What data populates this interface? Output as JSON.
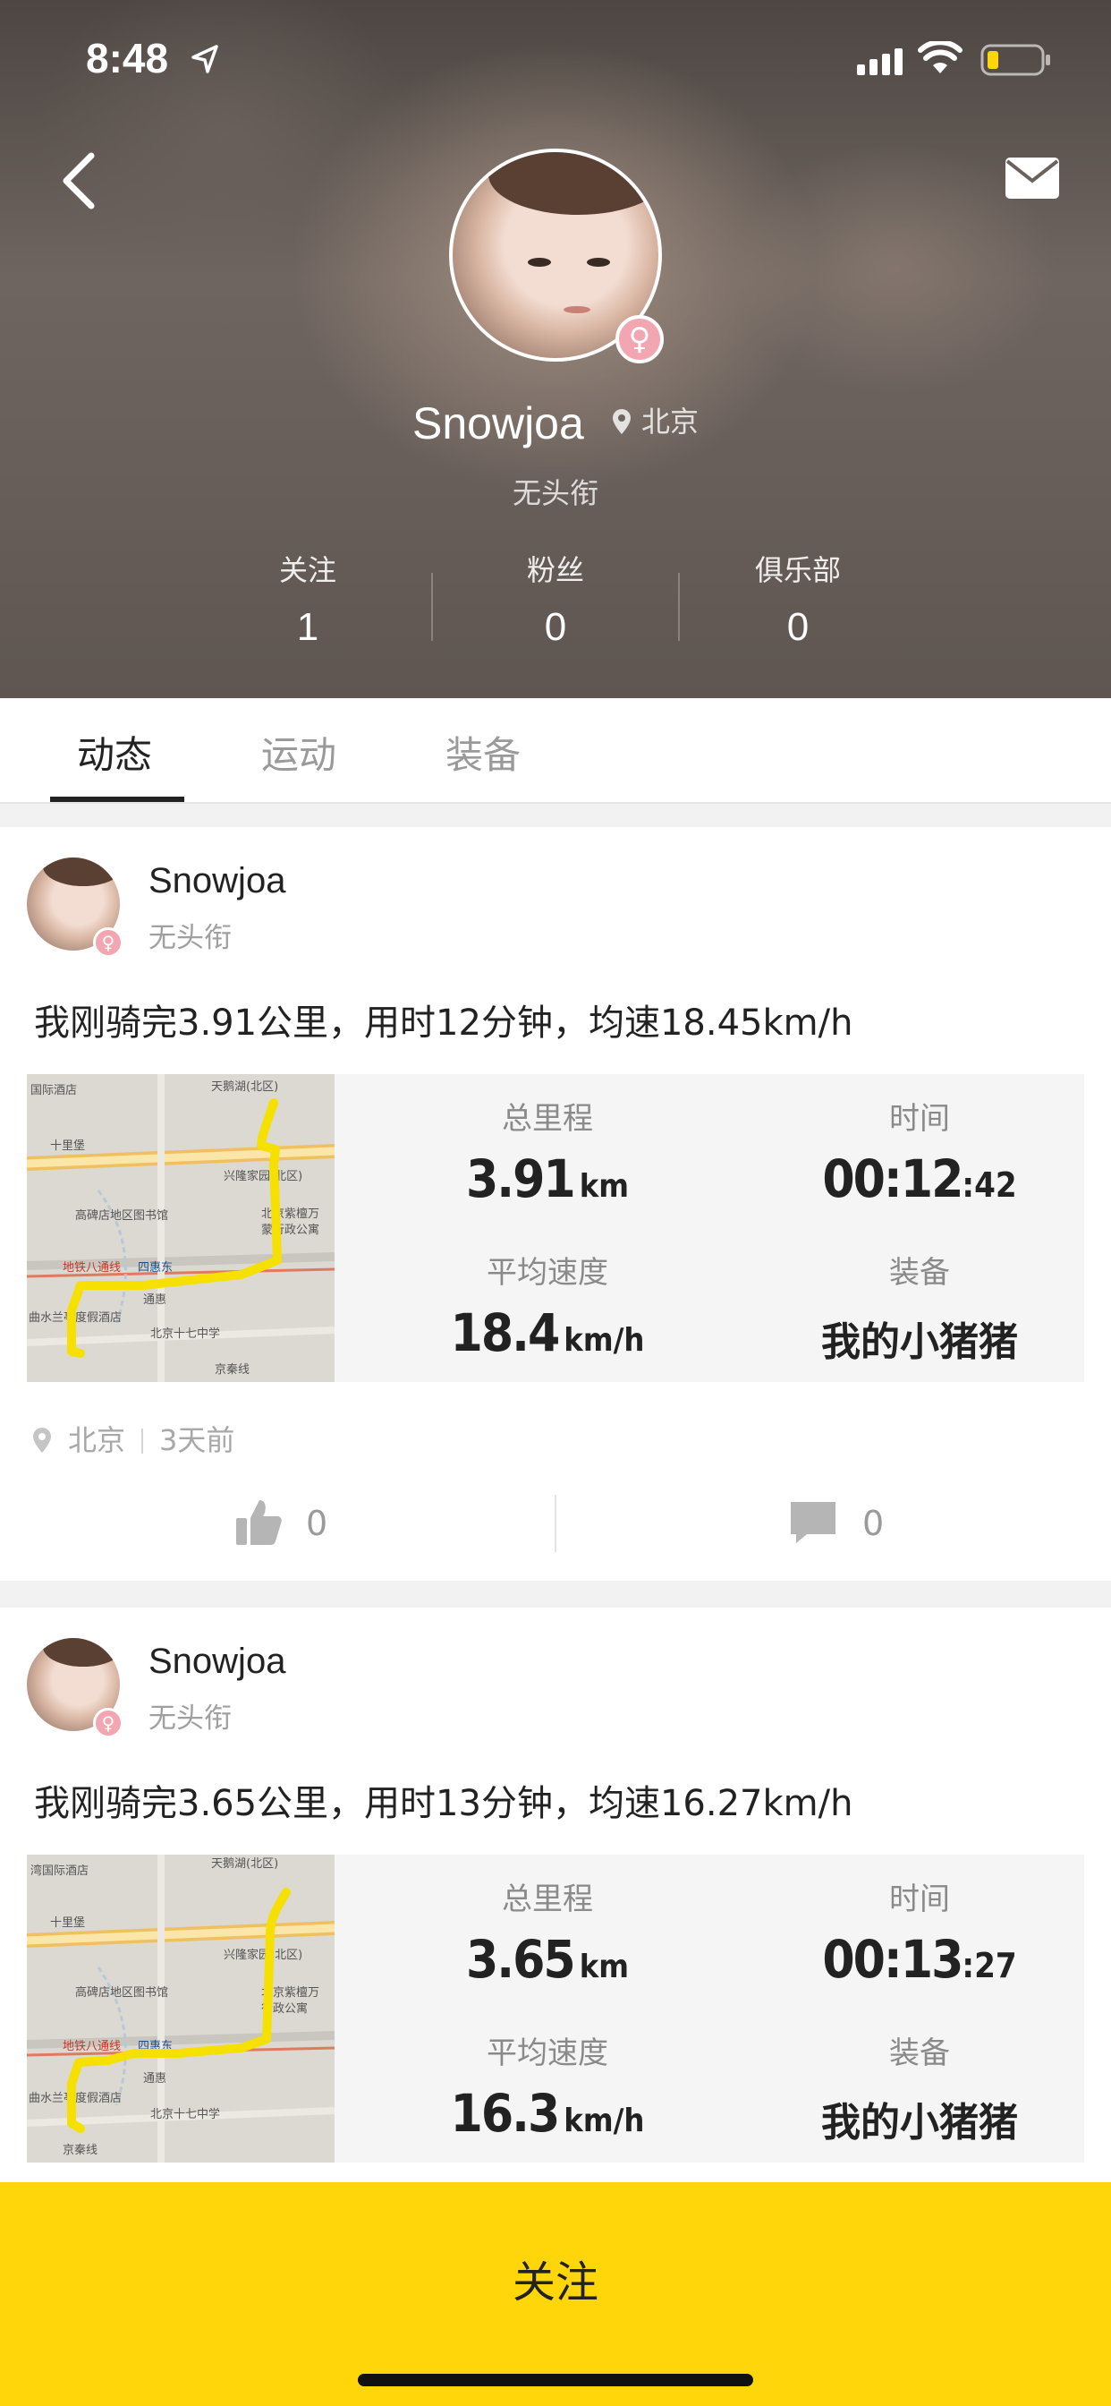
{
  "status_bar": {
    "time": "8:48"
  },
  "profile": {
    "username": "Snowjoa",
    "location": "北京",
    "signature": "无头衔",
    "gender_symbol": "♀",
    "stats": [
      {
        "label": "关注",
        "value": "1"
      },
      {
        "label": "粉丝",
        "value": "0"
      },
      {
        "label": "俱乐部",
        "value": "0"
      }
    ]
  },
  "tabs": [
    {
      "label": "动态",
      "active": true
    },
    {
      "label": "运动",
      "active": false
    },
    {
      "label": "装备",
      "active": false
    }
  ],
  "feed": [
    {
      "username": "Snowjoa",
      "signature": "无头衔",
      "text": "我刚骑完3.91公里，用时12分钟，均速18.45km/h",
      "distance_label": "总里程",
      "distance_value": "3.91",
      "distance_unit": "km",
      "time_label": "时间",
      "time_main": "00:12",
      "time_secs": ":42",
      "speed_label": "平均速度",
      "speed_value": "18.4",
      "speed_unit": "km/h",
      "gear_label": "装备",
      "gear_value": "我的小猪猪",
      "location": "北京",
      "time_ago": "3天前",
      "likes": "0",
      "comments": "0"
    },
    {
      "username": "Snowjoa",
      "signature": "无头衔",
      "text": "我刚骑完3.65公里，用时13分钟，均速16.27km/h",
      "distance_label": "总里程",
      "distance_value": "3.65",
      "distance_unit": "km",
      "time_label": "时间",
      "time_main": "00:13",
      "time_secs": ":27",
      "speed_label": "平均速度",
      "speed_value": "16.3",
      "speed_unit": "km/h",
      "gear_label": "装备",
      "gear_value": "我的小猪猪"
    }
  ],
  "map_labels": {
    "m1": [
      "国际酒店",
      "天鹅湖(北区)",
      "十里堡",
      "兴隆家园(北区)",
      "高碑店地区图书馆",
      "北京紫檀万",
      "蒙行政公寓",
      "地铁八通线",
      "四惠东",
      "通惠",
      "曲水兰亭度假酒店",
      "北京十七中学",
      "京秦线"
    ],
    "m2": [
      "湾国际酒店",
      "天鹅湖(北区)",
      "十里堡",
      "兴隆家园(北区)",
      "高碑店地区图书馆",
      "北京紫檀万",
      "行政公寓",
      "地铁八通线",
      "四惠东",
      "通惠",
      "曲水兰亭度假酒店",
      "北京十七中学",
      "京秦线"
    ]
  },
  "follow_button": {
    "label": "关注"
  },
  "colors": {
    "accent": "#ffd60a",
    "route": "#f5e000",
    "female": "#f2a6b1"
  }
}
